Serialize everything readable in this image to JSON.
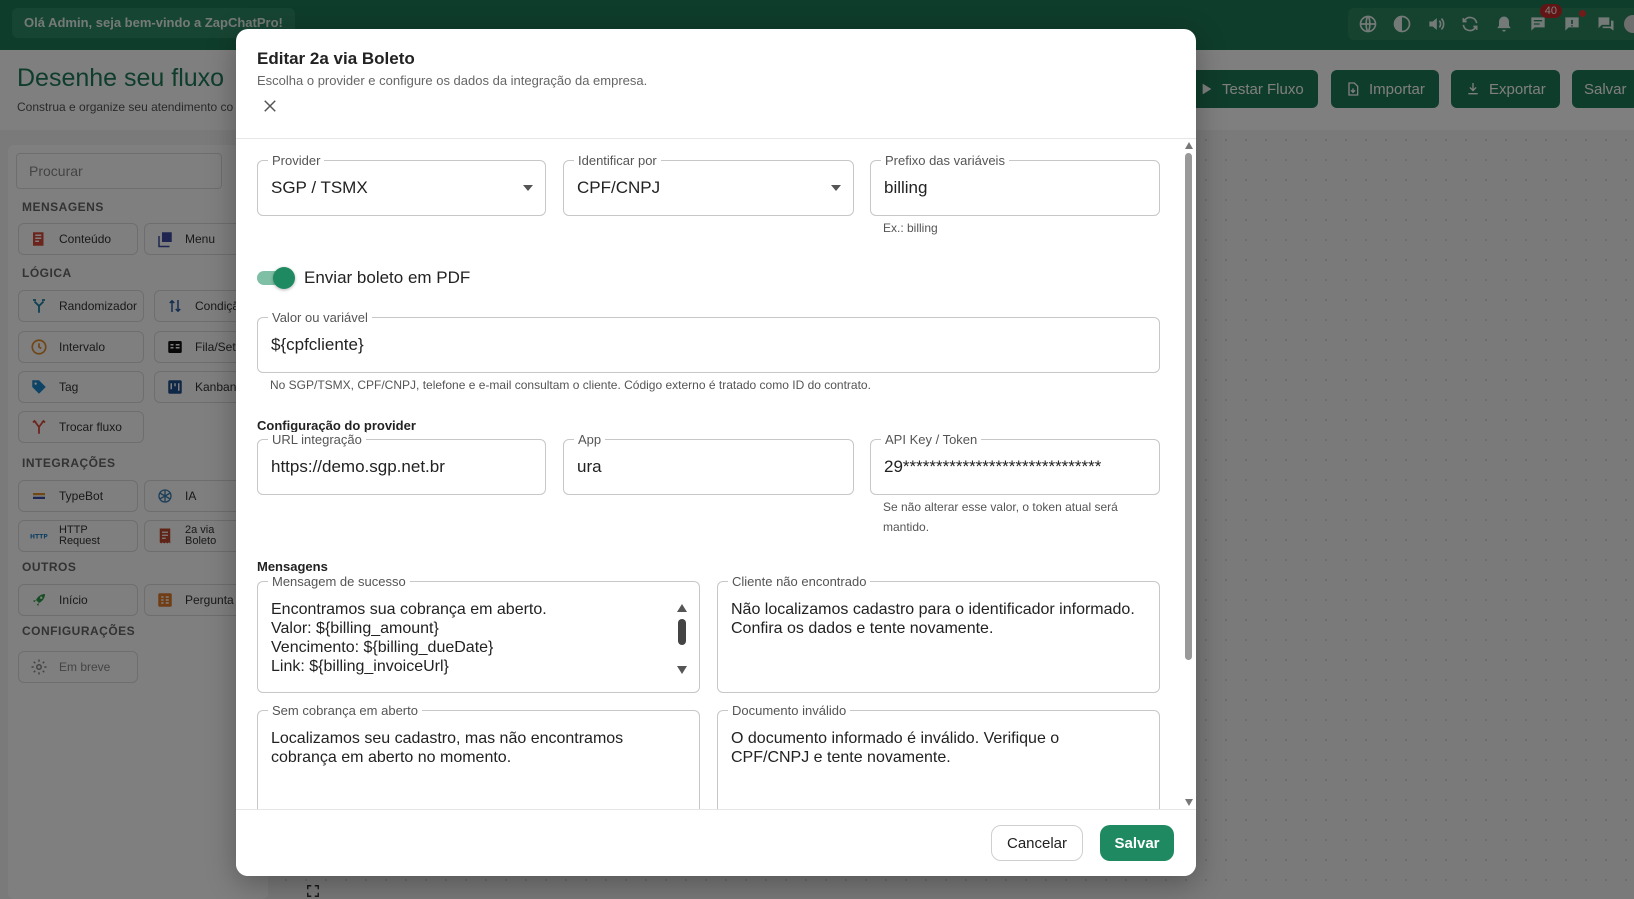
{
  "topbar": {
    "welcome": "Olá Admin, seja bem-vindo a ZapChatPro!",
    "notification_count": "40"
  },
  "header": {
    "title": "Desenhe seu fluxo",
    "subtitle": "Construa e organize seu atendimento co",
    "buttons": {
      "test": "Testar Fluxo",
      "import": "Importar",
      "export": "Exportar",
      "save": "Salvar"
    }
  },
  "sidebar": {
    "search_placeholder": "Procurar",
    "sections": {
      "messages": "MENSAGENS",
      "logic": "LÓGICA",
      "integrations": "INTEGRAÇÕES",
      "others": "OUTROS",
      "settings": "CONFIGURAÇÕES"
    },
    "nodes": {
      "content": "Conteúdo",
      "menu": "Menu",
      "randomizer": "Randomizador",
      "condition": "Condiçã",
      "interval": "Intervalo",
      "queue": "Fila/Set",
      "tag": "Tag",
      "kanban": "Kanban",
      "switch_flow": "Trocar fluxo",
      "typebot": "TypeBot",
      "ai": "IA",
      "http_request": "HTTP Request",
      "boleto": "2a via Boleto",
      "start": "Início",
      "question": "Pergunta",
      "coming_soon": "Em breve"
    }
  },
  "modal": {
    "title": "Editar 2a via Boleto",
    "subtitle": "Escolha o provider e configure os dados da integração da empresa.",
    "provider": {
      "label": "Provider",
      "value": "SGP / TSMX"
    },
    "identify_by": {
      "label": "Identificar por",
      "value": "CPF/CNPJ"
    },
    "var_prefix": {
      "label": "Prefixo das variáveis",
      "value": "billing",
      "helper": "Ex.: billing"
    },
    "send_pdf": {
      "label": "Enviar boleto em PDF",
      "enabled": true
    },
    "value_var": {
      "label": "Valor ou variável",
      "value": "${cpfcliente}",
      "helper": "No SGP/TSMX, CPF/CNPJ, telefone e e-mail consultam o cliente. Código externo é tratado como ID do contrato."
    },
    "provider_config": {
      "heading": "Configuração do provider",
      "url": {
        "label": "URL integração",
        "value": "https://demo.sgp.net.br"
      },
      "app": {
        "label": "App",
        "value": "ura"
      },
      "token": {
        "label": "API Key / Token",
        "value": "29******************************",
        "helper": "Se não alterar esse valor, o token atual será mantido."
      }
    },
    "messages": {
      "heading": "Mensagens",
      "success": {
        "label": "Mensagem de sucesso",
        "value": "Encontramos sua cobrança em aberto.\nValor: ${billing_amount}\nVencimento: ${billing_dueDate}\nLink: ${billing_invoiceUrl}"
      },
      "not_found": {
        "label": "Cliente não encontrado",
        "value": "Não localizamos cadastro para o identificador informado. Confira os dados e tente novamente."
      },
      "no_billing": {
        "label": "Sem cobrança em aberto",
        "value": "Localizamos seu cadastro, mas não encontramos cobrança em aberto no momento."
      },
      "invalid_doc": {
        "label": "Documento inválido",
        "value": "O documento informado é inválido. Verifique o CPF/CNPJ e tente novamente."
      }
    },
    "footer": {
      "cancel": "Cancelar",
      "save": "Salvar"
    }
  },
  "colors": {
    "brand": "#1f7a57",
    "primary_button": "#1f8a62",
    "toggle_track": "#7fbfa5"
  }
}
